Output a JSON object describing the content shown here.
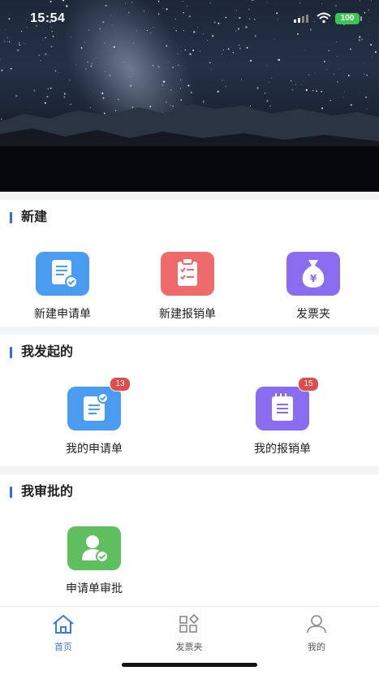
{
  "status_bar": {
    "time": "15:54",
    "battery": "100"
  },
  "sections": [
    {
      "title": "新建",
      "tiles": [
        {
          "label": "新建申请单",
          "icon": "application-form-icon",
          "color": "#4a9cf0"
        },
        {
          "label": "新建报销单",
          "icon": "reimbursement-clipboard-icon",
          "color": "#ef6a6a"
        },
        {
          "label": "发票夹",
          "icon": "money-bag-icon",
          "color": "#8a6cf0"
        }
      ]
    },
    {
      "title": "我发起的",
      "tiles": [
        {
          "label": "我的申请单",
          "icon": "my-application-icon",
          "color": "#4a9cf0",
          "badge": "13"
        },
        {
          "label": "我的报销单",
          "icon": "my-reimbursement-icon",
          "color": "#8a6cf0",
          "badge": "15"
        }
      ]
    },
    {
      "title": "我审批的",
      "tiles": [
        {
          "label": "申请单审批",
          "icon": "approval-user-icon",
          "color": "#5fbf5f"
        }
      ]
    }
  ],
  "tabbar": [
    {
      "label": "首页",
      "icon": "home-icon",
      "active": true
    },
    {
      "label": "发票夹",
      "icon": "grid-icon",
      "active": false
    },
    {
      "label": "我的",
      "icon": "user-icon",
      "active": false
    }
  ],
  "colors": {
    "accent": "#2f6fd6",
    "tab_active": "#3a7be0",
    "tab_inactive": "#888888"
  }
}
